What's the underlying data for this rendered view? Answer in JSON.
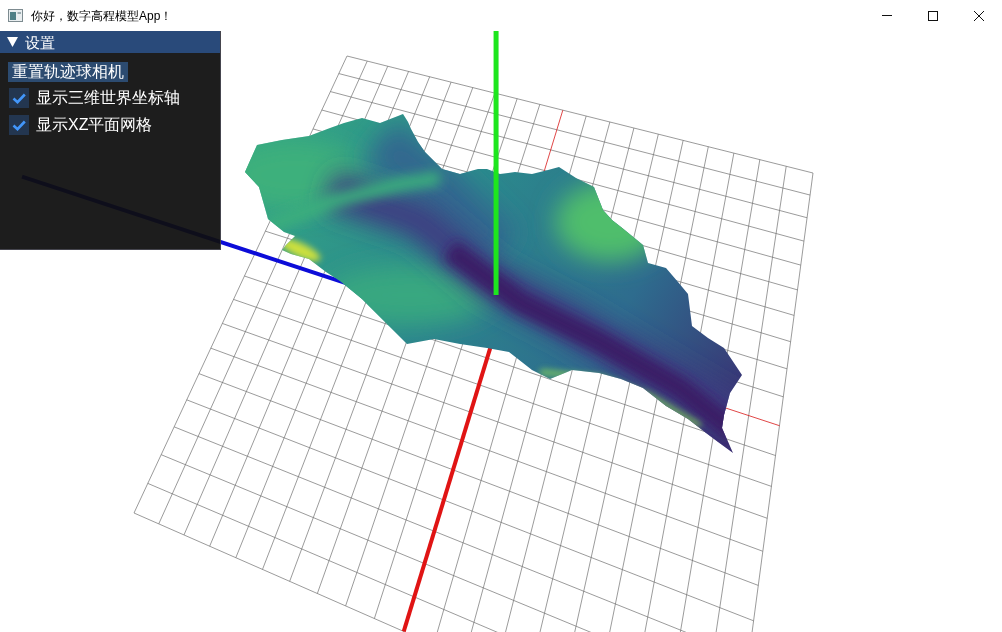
{
  "window": {
    "title": "你好，数字高程模型App！"
  },
  "settings_panel": {
    "title": "设置",
    "expanded": true,
    "button": "重置轨迹球相机",
    "checkboxes": [
      {
        "label": "显示三维世界坐标轴",
        "checked": true
      },
      {
        "label": "显示XZ平面网格",
        "checked": true
      }
    ]
  }
}
